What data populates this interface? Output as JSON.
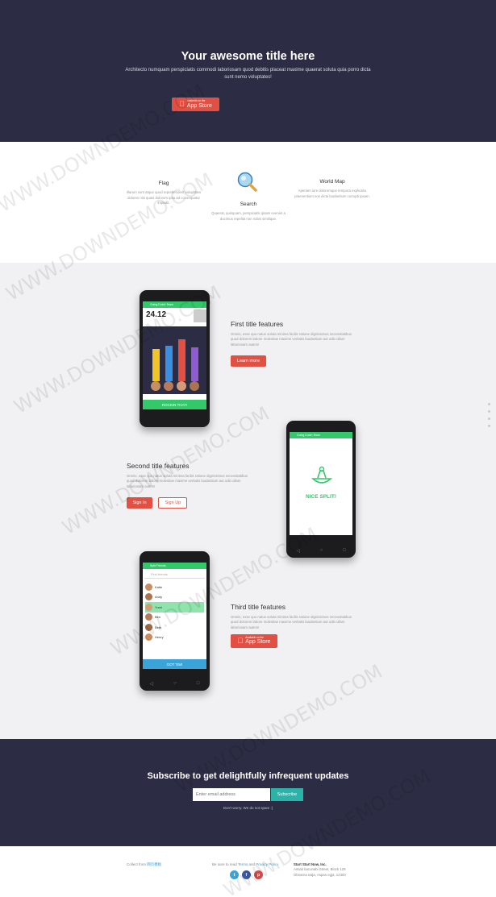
{
  "hero": {
    "title": "Your awesome title here",
    "description": "Architecto numquam perspiciatis commodi laboriosam quod debitis placeat maxime quaerat soluta quia porro dicta sunt nemo voluptates!",
    "store_small": "Available on the",
    "store_big": "App Store"
  },
  "trio": [
    {
      "title": "Flag",
      "text": "Illarum sunt atque quod reprehenderit voluptates dolores nisi quasi dolorum ipsa ad consequatur impedit."
    },
    {
      "title": "Search",
      "text": "Quaerat, quisquam, perspiciatis ipsam eveniet a ducimus repellat non nobis similique."
    },
    {
      "title": "World Map",
      "text": "Aperiam iure doloremque tempora explicabo praesentium eos dicta laudantium corrupti ipsam."
    }
  ],
  "features": [
    {
      "title": "First title features",
      "text": "Omnis, esse quo natus soluta minima facilis ratione dignissimos necessitatibus quod dolorem labore molestiae maxime veritatis laudantium aut odio ullam laboriosam autem!",
      "button": "Learn more"
    },
    {
      "title": "Second title features",
      "text": "Omnis, esse quo natus soluta minima facilis ratione dignissimos necessitatibus quod dolorem labore molestiae maxime veritatis laudantium aut odio ullam laboriosam autem!",
      "button1": "Sign In",
      "button2": "Sign Up"
    },
    {
      "title": "Third title features",
      "text": "Omnis, esse quo natus soluta minima facilis ratione dignissimos necessitatibus quod dolorem labore molestiae maxime veritatis laudantium aut odio ullam laboriosam autem!",
      "store_small": "Available on the",
      "store_big": "App Store"
    }
  ],
  "phones": {
    "p1": {
      "bar": "Going Dutch Team",
      "amount": "24.12",
      "action": "ROCKIN THAT!"
    },
    "p2": {
      "bar": "Going Dutch Team",
      "message": "NICE SPLIT!"
    },
    "p3": {
      "bar": "Split Friends",
      "search": "Find friends",
      "names": [
        "Katie",
        "Andy",
        "Yumi",
        "Ben",
        "Beth",
        "Henry"
      ],
      "action": "GOT 'EM!"
    }
  },
  "subscribe": {
    "title": "Subscribe to get delightfully infrequent updates",
    "placeholder": "Enter email address",
    "button": "Subscribe",
    "note": "Don't worry. We do not spam :)"
  },
  "footer": {
    "collect_prefix": "Collect from",
    "collect_link": "网页模板",
    "terms_prefix": "Be sure to read",
    "terms_link": "Terms",
    "terms_and": "and",
    "privacy_link": "Privacy Policy",
    "company": "Start Start Now, Inc.",
    "address1": "Antiati bacunabi Street, Block 129",
    "address2": "Obnarna salja, Aspan egja, 12300",
    "social": [
      "t",
      "f",
      "p"
    ]
  },
  "watermark": "WWW.DOWNDEMO.COM",
  "colors": {
    "navy": "#2c2d44",
    "red": "#e24f43",
    "green": "#33c86a",
    "teal": "#2bb3a9"
  }
}
